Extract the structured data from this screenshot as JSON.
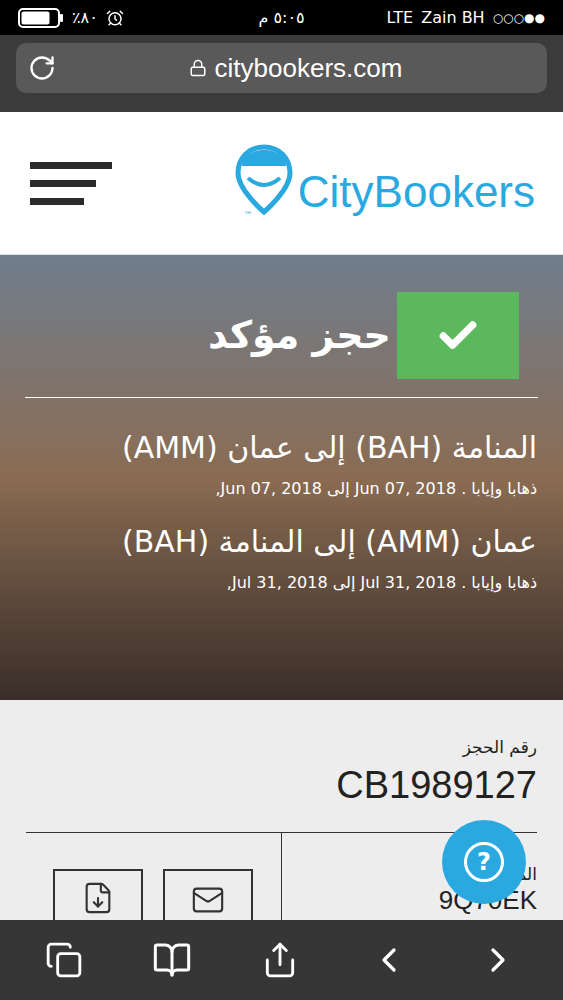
{
  "status_bar": {
    "battery": "٪٨٠",
    "battery_level": 0.8,
    "time": "٥:٠٥ م",
    "network": "LTE",
    "carrier": "Zain BH",
    "signal": "○○○●●"
  },
  "address_bar": {
    "url": "citybookers.com"
  },
  "header": {
    "logo": "CityBookers",
    "trademark": "™"
  },
  "hero": {
    "status": "حجز مؤكد",
    "confirmed": true,
    "flights": [
      {
        "route": "المنامة (BAH) إلى عمان (AMM)",
        "details": "ذهابا وإيابا . Jun 07, 2018 إلى Jun 07, 2018,"
      },
      {
        "route": "عمان (AMM) إلى المنامة (BAH)",
        "details": "ذهابا وإيابا . Jul 31, 2018 إلى Jul 31, 2018,"
      }
    ]
  },
  "booking": {
    "number_label": "رقم الحجز",
    "number": "CB1989127",
    "reference_label": "المر",
    "reference": "9Q70EK"
  },
  "help_button": "?"
}
